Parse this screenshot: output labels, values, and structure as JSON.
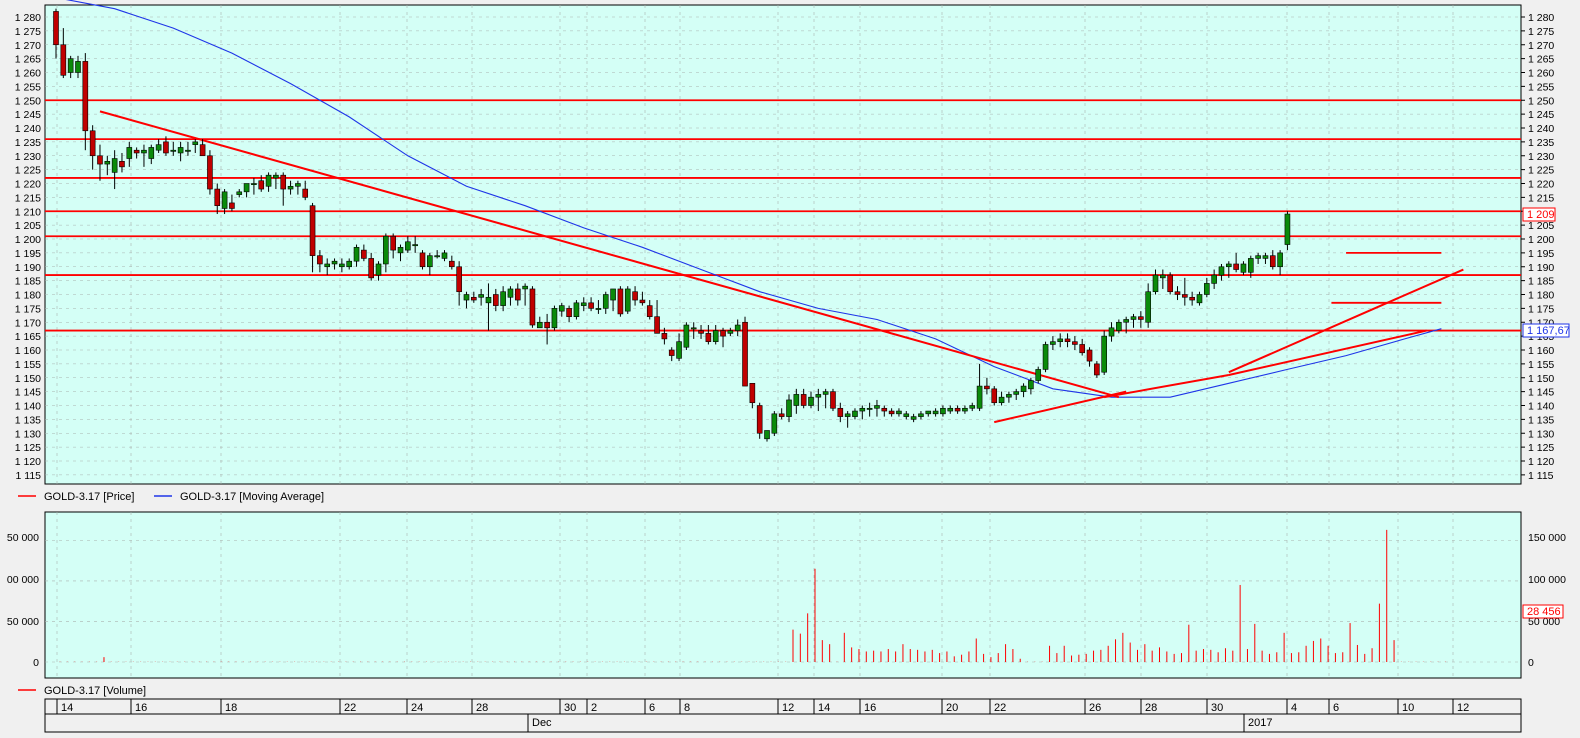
{
  "colors": {
    "panel_bg": "#d4fff6",
    "up_candle": "#0a8a0a",
    "down_candle": "#c00000",
    "moving_average": "#1f35e8",
    "trendlines": "#ff0000",
    "volume_bars": "#ff0000",
    "grid": "#a9b4b0"
  },
  "price_panel": {
    "legend": [
      {
        "label": "GOLD-3.17 [Price]",
        "color": "#ff0000"
      },
      {
        "label": "GOLD-3.17 [Moving Average]",
        "color": "#1f35e8"
      }
    ],
    "last_price_label": "1 209",
    "ma_label": "1 167,67",
    "y_ticks": [
      "1 280",
      "1 275",
      "1 270",
      "1 265",
      "1 260",
      "1 255",
      "1 250",
      "1 245",
      "1 240",
      "1 235",
      "1 230",
      "1 225",
      "1 220",
      "1 215",
      "1 210",
      "1 205",
      "1 200",
      "1 195",
      "1 190",
      "1 185",
      "1 180",
      "1 175",
      "1 170",
      "1 165",
      "1 160",
      "1 155",
      "1 150",
      "1 145",
      "1 140",
      "1 135",
      "1 130",
      "1 125",
      "1 120",
      "1 115"
    ]
  },
  "volume_panel": {
    "legend": [
      {
        "label": "GOLD-3.17 [Volume]",
        "color": "#ff0000"
      }
    ],
    "last_volume_label": "28 456",
    "left_ticks": [
      "50 000",
      "00 000",
      "50 000",
      "0"
    ],
    "right_ticks": [
      "150 000",
      "100 000",
      "50 000",
      "0"
    ]
  },
  "time_axis": {
    "day_labels": [
      "14",
      "16",
      "18",
      "22",
      "24",
      "28",
      "30",
      "2",
      "6",
      "8",
      "12",
      "14",
      "16",
      "20",
      "22",
      "26",
      "28",
      "30",
      "4",
      "6",
      "10",
      "12"
    ],
    "period_labels": [
      "Dec",
      "2017"
    ]
  },
  "chart_data": {
    "type": "candlestick",
    "instrument": "GOLD-3.17",
    "price_axis": {
      "min": 1115,
      "max": 1280,
      "step": 5
    },
    "volume_axis": {
      "left_ticks": [
        50000,
        100000,
        50000,
        0
      ],
      "right_ticks": [
        150000,
        100000,
        50000,
        0
      ]
    },
    "candles": [
      [
        1282,
        1283,
        1265,
        1270
      ],
      [
        1270,
        1276,
        1258,
        1259
      ],
      [
        1260,
        1266,
        1258,
        1265
      ],
      [
        1260,
        1266,
        1258,
        1264
      ],
      [
        1264,
        1267,
        1232,
        1239
      ],
      [
        1239,
        1241,
        1225,
        1230
      ],
      [
        1230,
        1234,
        1221,
        1227
      ],
      [
        1227,
        1230,
        1223,
        1228
      ],
      [
        1224,
        1232,
        1218,
        1229
      ],
      [
        1228,
        1231,
        1224,
        1226
      ],
      [
        1229,
        1235,
        1226,
        1233
      ],
      [
        1232,
        1233,
        1229,
        1231
      ],
      [
        1231,
        1234,
        1226,
        1232
      ],
      [
        1229,
        1234,
        1227,
        1233
      ],
      [
        1232,
        1236,
        1231,
        1234
      ],
      [
        1235,
        1237,
        1230,
        1231
      ],
      [
        1232,
        1235,
        1230,
        1232
      ],
      [
        1231,
        1235,
        1228,
        1233
      ],
      [
        1232,
        1235,
        1230,
        1232
      ],
      [
        1234,
        1236,
        1231,
        1235
      ],
      [
        1234,
        1236,
        1230,
        1230
      ],
      [
        1230,
        1232,
        1216,
        1218
      ],
      [
        1218,
        1220,
        1209,
        1212
      ],
      [
        1211,
        1218,
        1209,
        1217
      ],
      [
        1213,
        1216,
        1210,
        1211
      ],
      [
        1216,
        1218,
        1215,
        1217
      ],
      [
        1217,
        1220,
        1215,
        1220
      ],
      [
        1220,
        1222,
        1216,
        1220
      ],
      [
        1221,
        1223,
        1217,
        1218
      ],
      [
        1219,
        1224,
        1217,
        1223
      ],
      [
        1222,
        1224,
        1218,
        1223
      ],
      [
        1223,
        1224,
        1212,
        1218
      ],
      [
        1218,
        1221,
        1216,
        1219
      ],
      [
        1219,
        1221,
        1216,
        1220
      ],
      [
        1218,
        1221,
        1214,
        1215
      ],
      [
        1212,
        1213,
        1188,
        1194
      ],
      [
        1194,
        1196,
        1188,
        1191
      ],
      [
        1190,
        1193,
        1187,
        1191
      ],
      [
        1191,
        1193,
        1189,
        1192
      ],
      [
        1190,
        1193,
        1188,
        1191
      ],
      [
        1190,
        1193,
        1189,
        1192
      ],
      [
        1192,
        1198,
        1190,
        1197
      ],
      [
        1196,
        1198,
        1192,
        1193
      ],
      [
        1193,
        1195,
        1185,
        1186
      ],
      [
        1187,
        1192,
        1185,
        1191
      ],
      [
        1191,
        1202,
        1188,
        1201
      ],
      [
        1201,
        1202,
        1193,
        1196
      ],
      [
        1195,
        1198,
        1192,
        1197
      ],
      [
        1196,
        1201,
        1195,
        1199
      ],
      [
        1198,
        1201,
        1195,
        1198
      ],
      [
        1195,
        1196,
        1189,
        1190
      ],
      [
        1190,
        1195,
        1187,
        1194
      ],
      [
        1194,
        1196,
        1193,
        1194
      ],
      [
        1193,
        1196,
        1192,
        1195
      ],
      [
        1192,
        1194,
        1189,
        1190
      ],
      [
        1190,
        1192,
        1176,
        1181
      ],
      [
        1178,
        1181,
        1175,
        1180
      ],
      [
        1179,
        1181,
        1177,
        1178
      ],
      [
        1179,
        1182,
        1176,
        1180
      ],
      [
        1177,
        1184,
        1167,
        1179
      ],
      [
        1180,
        1182,
        1174,
        1176
      ],
      [
        1176,
        1183,
        1174,
        1181
      ],
      [
        1179,
        1183,
        1176,
        1182
      ],
      [
        1182,
        1184,
        1176,
        1178
      ],
      [
        1182,
        1184,
        1176,
        1183
      ],
      [
        1182,
        1183,
        1168,
        1169
      ],
      [
        1168,
        1172,
        1168,
        1170
      ],
      [
        1170,
        1173,
        1162,
        1168
      ],
      [
        1168,
        1176,
        1167,
        1175
      ],
      [
        1174,
        1177,
        1172,
        1176
      ],
      [
        1175,
        1176,
        1170,
        1172
      ],
      [
        1172,
        1178,
        1171,
        1177
      ],
      [
        1176,
        1179,
        1174,
        1177
      ],
      [
        1177,
        1179,
        1174,
        1175
      ],
      [
        1175,
        1178,
        1173,
        1175
      ],
      [
        1175,
        1181,
        1173,
        1180
      ],
      [
        1178,
        1182,
        1174,
        1182
      ],
      [
        1182,
        1183,
        1172,
        1173
      ],
      [
        1174,
        1183,
        1173,
        1182
      ],
      [
        1181,
        1183,
        1176,
        1178
      ],
      [
        1178,
        1181,
        1176,
        1177
      ],
      [
        1176,
        1178,
        1171,
        1172
      ],
      [
        1172,
        1178,
        1166,
        1166
      ],
      [
        1166,
        1168,
        1162,
        1164
      ],
      [
        1160,
        1161,
        1156,
        1158
      ],
      [
        1157,
        1166,
        1156,
        1163
      ],
      [
        1161,
        1170,
        1160,
        1169
      ],
      [
        1168,
        1170,
        1164,
        1168
      ],
      [
        1167,
        1169,
        1164,
        1166
      ],
      [
        1166,
        1169,
        1162,
        1163
      ],
      [
        1163,
        1169,
        1162,
        1167
      ],
      [
        1167,
        1168,
        1161,
        1165
      ],
      [
        1166,
        1168,
        1165,
        1167
      ],
      [
        1167,
        1171,
        1165,
        1169
      ],
      [
        1170,
        1172,
        1165,
        1147
      ],
      [
        1148,
        1148,
        1139,
        1141
      ],
      [
        1140,
        1141,
        1128,
        1130
      ],
      [
        1128,
        1131,
        1127,
        1131
      ],
      [
        1130,
        1138,
        1129,
        1137
      ],
      [
        1137,
        1139,
        1135,
        1136
      ],
      [
        1136,
        1144,
        1134,
        1142
      ],
      [
        1140,
        1146,
        1137,
        1144
      ],
      [
        1144,
        1146,
        1139,
        1140
      ],
      [
        1140,
        1145,
        1139,
        1143
      ],
      [
        1143,
        1146,
        1138,
        1144
      ],
      [
        1144,
        1146,
        1139,
        1145
      ],
      [
        1145,
        1146,
        1138,
        1139
      ],
      [
        1139,
        1141,
        1134,
        1136
      ],
      [
        1136,
        1138,
        1132,
        1137
      ],
      [
        1136,
        1139,
        1135,
        1138
      ],
      [
        1138,
        1140,
        1135,
        1139
      ],
      [
        1139,
        1141,
        1136,
        1139
      ],
      [
        1139,
        1142,
        1136,
        1140
      ],
      [
        1139,
        1140,
        1136,
        1138
      ],
      [
        1138,
        1139,
        1136,
        1137
      ],
      [
        1137,
        1139,
        1136,
        1138
      ],
      [
        1136,
        1138,
        1135,
        1137
      ],
      [
        1135,
        1137,
        1134,
        1136
      ],
      [
        1136,
        1138,
        1135,
        1137
      ],
      [
        1137,
        1138,
        1136,
        1138
      ],
      [
        1137,
        1139,
        1136,
        1138
      ],
      [
        1137,
        1140,
        1136,
        1139
      ],
      [
        1138,
        1140,
        1137,
        1139
      ],
      [
        1139,
        1140,
        1137,
        1138
      ],
      [
        1138,
        1140,
        1137,
        1139
      ],
      [
        1139,
        1141,
        1138,
        1140
      ],
      [
        1139,
        1155,
        1138,
        1147
      ],
      [
        1147,
        1150,
        1144,
        1146
      ],
      [
        1146,
        1147,
        1140,
        1141
      ],
      [
        1141,
        1145,
        1140,
        1143
      ],
      [
        1143,
        1145,
        1141,
        1144
      ],
      [
        1144,
        1146,
        1142,
        1145
      ],
      [
        1145,
        1148,
        1143,
        1147
      ],
      [
        1146,
        1150,
        1144,
        1149
      ],
      [
        1149,
        1154,
        1148,
        1153
      ],
      [
        1153,
        1163,
        1152,
        1162
      ],
      [
        1162,
        1165,
        1160,
        1163
      ],
      [
        1163,
        1166,
        1161,
        1164
      ],
      [
        1164,
        1166,
        1161,
        1163
      ],
      [
        1163,
        1165,
        1160,
        1162
      ],
      [
        1162,
        1164,
        1158,
        1159
      ],
      [
        1160,
        1161,
        1154,
        1156
      ],
      [
        1155,
        1156,
        1150,
        1151
      ],
      [
        1152,
        1167,
        1151,
        1165
      ],
      [
        1165,
        1170,
        1163,
        1168
      ],
      [
        1167,
        1171,
        1166,
        1170
      ],
      [
        1170,
        1172,
        1166,
        1171
      ],
      [
        1171,
        1173,
        1168,
        1172
      ],
      [
        1172,
        1174,
        1168,
        1171
      ],
      [
        1170,
        1184,
        1168,
        1181
      ],
      [
        1181,
        1189,
        1180,
        1187
      ],
      [
        1186,
        1189,
        1182,
        1187
      ],
      [
        1187,
        1188,
        1180,
        1181
      ],
      [
        1181,
        1183,
        1178,
        1180
      ],
      [
        1180,
        1186,
        1176,
        1179
      ],
      [
        1179,
        1181,
        1176,
        1178
      ],
      [
        1177,
        1181,
        1176,
        1180
      ],
      [
        1180,
        1186,
        1179,
        1184
      ],
      [
        1184,
        1189,
        1182,
        1187
      ],
      [
        1187,
        1191,
        1185,
        1190
      ],
      [
        1190,
        1192,
        1186,
        1191
      ],
      [
        1191,
        1195,
        1188,
        1189
      ],
      [
        1188,
        1192,
        1187,
        1191
      ],
      [
        1188,
        1194,
        1186,
        1193
      ],
      [
        1193,
        1195,
        1191,
        1194
      ],
      [
        1193,
        1195,
        1191,
        1194
      ],
      [
        1194,
        1196,
        1189,
        1190
      ],
      [
        1190,
        1196,
        1187,
        1195
      ],
      [
        1198,
        1210,
        1196,
        1209
      ]
    ],
    "moving_average": [
      [
        0,
        1287
      ],
      [
        8,
        1283
      ],
      [
        16,
        1276
      ],
      [
        24,
        1267
      ],
      [
        32,
        1256
      ],
      [
        40,
        1244
      ],
      [
        48,
        1230
      ],
      [
        56,
        1219
      ],
      [
        64,
        1212
      ],
      [
        72,
        1204
      ],
      [
        80,
        1197
      ],
      [
        88,
        1189
      ],
      [
        96,
        1181
      ],
      [
        104,
        1175
      ],
      [
        112,
        1171
      ],
      [
        120,
        1164
      ],
      [
        128,
        1154
      ],
      [
        136,
        1146
      ],
      [
        144,
        1143
      ],
      [
        152,
        1143
      ],
      [
        160,
        1148
      ],
      [
        168,
        1153
      ],
      [
        176,
        1158
      ],
      [
        184,
        1164
      ],
      [
        189,
        1167.67
      ]
    ],
    "levels": [
      1250,
      1236,
      1222,
      1210,
      1201,
      1187,
      1167
    ],
    "short_levels": [
      {
        "from": 176,
        "to": 189,
        "value": 1195
      },
      {
        "from": 174,
        "to": 189,
        "value": 1177
      }
    ],
    "trendlines": [
      {
        "from": [
          6,
          1246
        ],
        "to": [
          145,
          1143
        ]
      },
      {
        "from": [
          128,
          1134
        ],
        "to": [
          146,
          1145
        ]
      },
      {
        "from": [
          143,
          1143
        ],
        "to": [
          160,
          1151
        ]
      },
      {
        "from": [
          160,
          1151
        ],
        "to": [
          187,
          1167
        ]
      },
      {
        "from": [
          160,
          1152
        ],
        "to": [
          192,
          1189
        ]
      }
    ],
    "volume_max": 185000,
    "volumes": [
      300,
      300,
      300,
      300,
      300,
      300,
      300,
      300,
      300,
      300,
      300,
      300,
      300,
      300,
      300,
      300,
      300,
      300,
      300,
      300,
      300,
      300,
      300,
      300,
      300,
      300,
      300,
      300,
      300,
      300,
      300,
      300,
      300,
      300,
      300,
      300,
      300,
      300,
      300,
      300,
      300,
      300,
      300,
      300,
      300,
      300,
      300,
      300,
      300,
      300,
      300,
      300,
      300,
      300,
      300,
      300,
      300,
      300,
      300,
      300,
      300,
      300,
      300,
      300,
      300,
      300,
      300,
      300,
      300,
      300,
      300,
      300,
      300,
      300,
      300,
      300,
      300,
      300,
      300,
      300,
      300,
      300,
      300,
      300,
      300,
      300,
      300,
      300,
      300,
      300,
      300,
      300,
      300,
      300,
      300,
      300,
      300,
      300,
      300,
      300,
      300,
      300,
      300,
      300,
      300,
      300,
      300,
      300,
      300,
      300,
      300,
      300,
      300,
      300,
      300,
      300,
      300,
      300,
      300,
      300,
      300,
      300,
      300,
      300,
      300,
      300,
      300,
      300,
      300,
      300,
      300,
      300,
      300,
      300,
      300,
      300,
      300,
      300,
      300,
      300,
      300,
      300,
      300,
      300,
      300,
      300,
      300,
      300,
      300,
      300,
      300,
      300,
      300,
      300,
      300,
      300,
      300,
      300,
      300,
      300,
      300,
      300,
      300,
      300,
      300,
      300,
      300,
      300,
      300,
      300,
      300,
      300,
      300,
      300,
      300,
      300,
      300,
      300,
      300,
      300,
      300,
      300,
      300,
      300,
      300,
      300,
      300,
      300,
      300,
      300
    ]
  }
}
